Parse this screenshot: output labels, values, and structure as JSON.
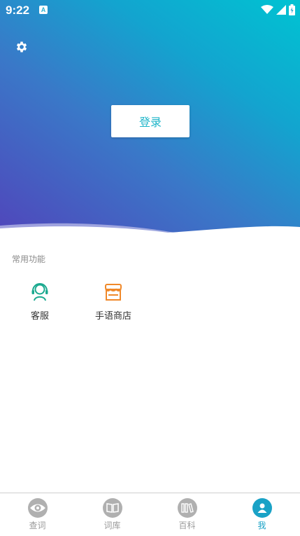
{
  "status_bar": {
    "time": "9:22",
    "notification_icon": "A"
  },
  "header": {
    "settings_icon": "gear-icon",
    "login_label": "登录"
  },
  "common": {
    "title": "常用功能",
    "items": [
      {
        "label": "客服",
        "icon": "headset-icon",
        "color": "#1aa98f"
      },
      {
        "label": "手语商店",
        "icon": "store-icon",
        "color": "#f0892a"
      }
    ]
  },
  "bottom_nav": {
    "items": [
      {
        "label": "查词",
        "icon": "eye-icon"
      },
      {
        "label": "词库",
        "icon": "book-icon"
      },
      {
        "label": "百科",
        "icon": "library-icon"
      },
      {
        "label": "我",
        "icon": "user-icon",
        "active": true
      }
    ]
  },
  "colors": {
    "accent": "#1aa2c6",
    "gradient_start": "#00c3d2",
    "gradient_end": "#5046bb"
  }
}
